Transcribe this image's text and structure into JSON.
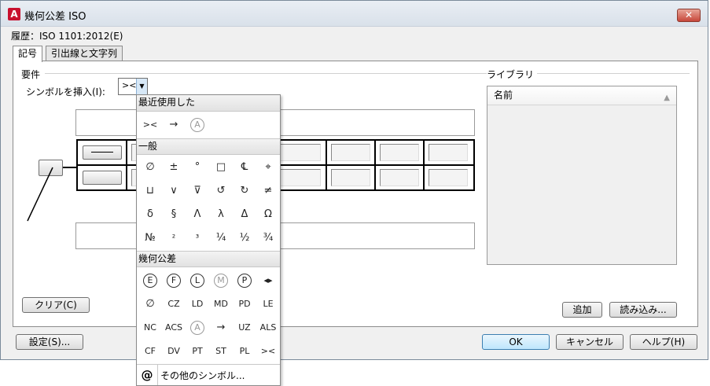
{
  "window": {
    "title": "幾何公差 ISO",
    "app_icon": "A",
    "close_label": "✕",
    "history": "履歴：ISO 1101:2012(E)"
  },
  "tabs": [
    {
      "label": "記号",
      "active": true
    },
    {
      "label": "引出線と文字列",
      "active": false
    }
  ],
  "requirements": {
    "group_label": "要件",
    "insert_symbol_label": "シンボルを挿入(I):",
    "insert_symbol_value": "><",
    "clear_button": "クリア(C)"
  },
  "library": {
    "group_label": "ライブラリ",
    "column_header": "名前",
    "add_button": "追加",
    "load_button": "読み込み..."
  },
  "bottom_buttons": {
    "settings": "設定(S)...",
    "ok": "OK",
    "cancel": "キャンセル",
    "help": "ヘルプ(H)"
  },
  "symbol_popup": {
    "recent_label": "最近使用した",
    "recent": [
      "><",
      "→",
      "A"
    ],
    "general_label": "一般",
    "general_rows": [
      [
        "∅",
        "±",
        "°",
        "□",
        "℄",
        "⌖"
      ],
      [
        "⊔",
        "∨",
        "⊽",
        "↺",
        "↻",
        "≠"
      ],
      [
        "δ",
        "§",
        "Λ",
        "λ",
        "Δ",
        "Ω"
      ],
      [
        "№",
        "²",
        "³",
        "¼",
        "½",
        "¾"
      ]
    ],
    "gdt_label": "幾何公差",
    "gdt_row1": [
      "E",
      "F",
      "L",
      "M",
      "P",
      "◂▸"
    ],
    "gdt_row2": [
      "∅",
      "CZ",
      "LD",
      "MD",
      "PD",
      "LE"
    ],
    "gdt_row3": [
      "NC",
      "ACS",
      "A",
      "→",
      "UZ",
      "ALS"
    ],
    "gdt_row4": [
      "CF",
      "DV",
      "PT",
      "ST",
      "PL",
      "><"
    ],
    "other_symbols": "その他のシンボル...",
    "other_icon": "@"
  },
  "colors": {
    "accent": "#3c7fb1",
    "app_icon_red": "#c8102e",
    "close_red": "#c7473a"
  }
}
